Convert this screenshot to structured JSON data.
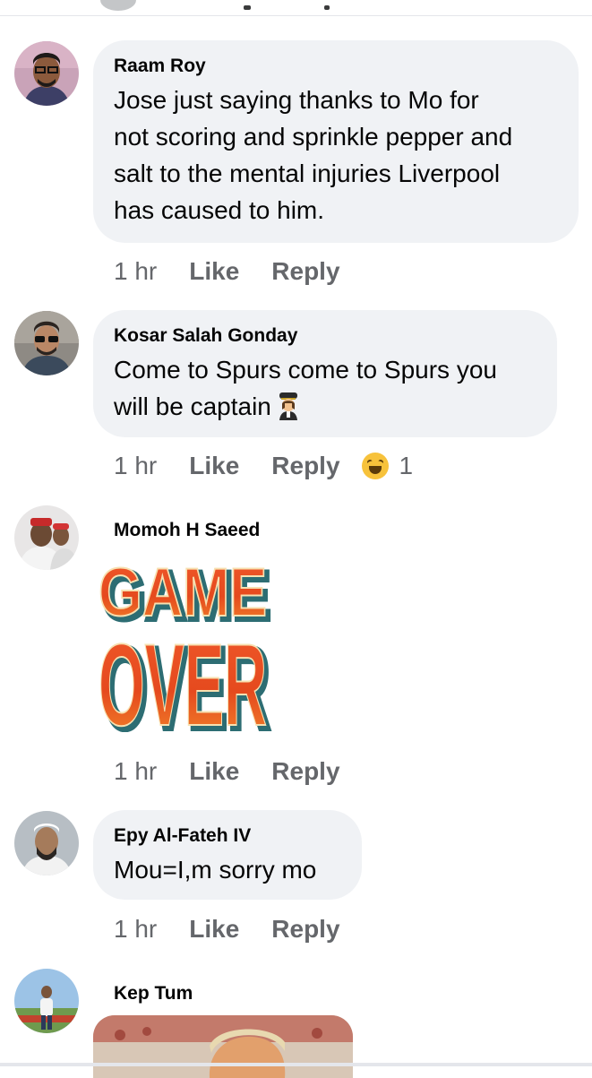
{
  "comments": [
    {
      "author": "Raam Roy",
      "text_lines": [
        "Jose just saying thanks to Mo for",
        "not scoring and sprinkle pepper and",
        "salt to the mental injuries Liverpool",
        "has caused to him."
      ],
      "time": "1 hr",
      "like_label": "Like",
      "reply_label": "Reply"
    },
    {
      "author": "Kosar Salah Gonday",
      "text_lines": [
        "Come to Spurs come to Spurs you",
        "will be captain"
      ],
      "emoji": "pilot-woman-emoji",
      "time": "1 hr",
      "like_label": "Like",
      "reply_label": "Reply",
      "reaction": {
        "icon": "haha-reaction-icon",
        "count": "1"
      }
    },
    {
      "author": "Momoh H Saeed",
      "gif": {
        "line1": "GAME",
        "line2": "OVER"
      },
      "time": "1 hr",
      "like_label": "Like",
      "reply_label": "Reply"
    },
    {
      "author": "Epy Al-Fateh IV",
      "text_lines": [
        "Mou=I,m sorry mo"
      ],
      "time": "1 hr",
      "like_label": "Like",
      "reply_label": "Reply"
    },
    {
      "author": "Kep Tum"
    }
  ]
}
